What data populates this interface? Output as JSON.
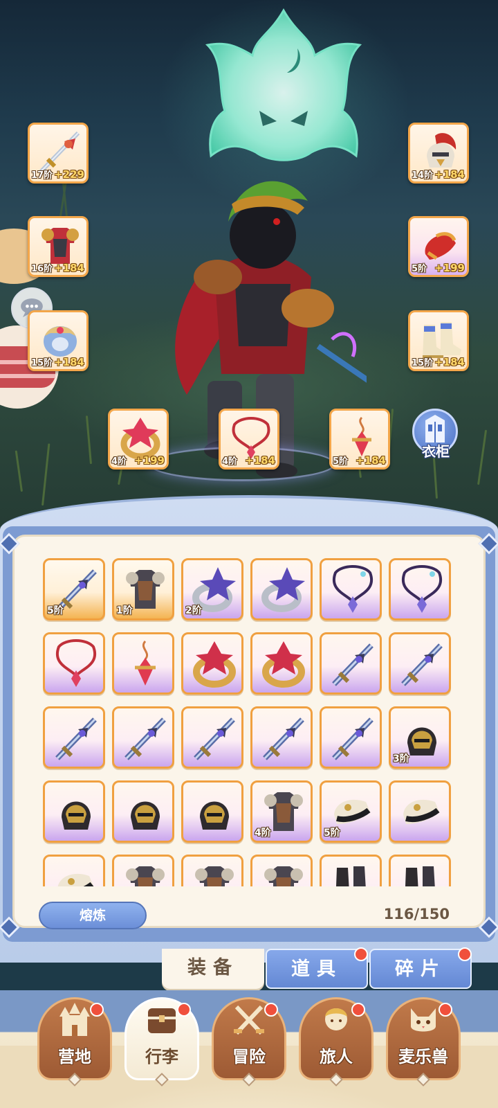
{
  "equipped": {
    "left": [
      {
        "item": "sword",
        "tier": "17阶",
        "bonus": "+229"
      },
      {
        "item": "armor",
        "tier": "16阶",
        "bonus": "+184"
      },
      {
        "item": "pauldron",
        "tier": "15阶",
        "bonus": "+184"
      }
    ],
    "right": [
      {
        "item": "helmet",
        "tier": "14阶",
        "bonus": "+184"
      },
      {
        "item": "gauntlet",
        "tier": "5阶",
        "bonus": "+199"
      },
      {
        "item": "boots",
        "tier": "15阶",
        "bonus": "+184"
      }
    ],
    "bottom": [
      {
        "item": "ring",
        "tier": "4阶",
        "bonus": "+199"
      },
      {
        "item": "necklace",
        "tier": "4阶",
        "bonus": "+184"
      },
      {
        "item": "charm",
        "tier": "5阶",
        "bonus": "+184"
      }
    ]
  },
  "wardrobe": {
    "label": "衣柜"
  },
  "inventory": {
    "items": [
      {
        "icon": "sword-icon",
        "tier": "5阶",
        "rarity": "gold"
      },
      {
        "icon": "armor-icon",
        "tier": "1阶",
        "rarity": "gold"
      },
      {
        "icon": "star-ring-icon",
        "tier": "2阶",
        "rarity": "purple"
      },
      {
        "icon": "star-ring-icon",
        "tier": "",
        "rarity": "purple"
      },
      {
        "icon": "necklace-icon",
        "tier": "",
        "rarity": "purple"
      },
      {
        "icon": "necklace-icon",
        "tier": "",
        "rarity": "purple"
      },
      {
        "icon": "red-necklace-icon",
        "tier": "",
        "rarity": "purple"
      },
      {
        "icon": "charm-icon",
        "tier": "",
        "rarity": "purple"
      },
      {
        "icon": "ruby-ring-icon",
        "tier": "",
        "rarity": "purple"
      },
      {
        "icon": "ruby-ring-icon",
        "tier": "",
        "rarity": "purple"
      },
      {
        "icon": "sword-icon",
        "tier": "",
        "rarity": "purple"
      },
      {
        "icon": "sword-icon",
        "tier": "",
        "rarity": "purple"
      },
      {
        "icon": "sword-icon",
        "tier": "",
        "rarity": "purple"
      },
      {
        "icon": "sword-icon",
        "tier": "",
        "rarity": "purple"
      },
      {
        "icon": "sword-icon",
        "tier": "",
        "rarity": "purple"
      },
      {
        "icon": "sword-icon",
        "tier": "",
        "rarity": "purple"
      },
      {
        "icon": "sword-icon",
        "tier": "",
        "rarity": "purple"
      },
      {
        "icon": "helmet-icon",
        "tier": "3阶",
        "rarity": "purple"
      },
      {
        "icon": "helmet-icon",
        "tier": "",
        "rarity": "purple"
      },
      {
        "icon": "helmet-icon",
        "tier": "",
        "rarity": "purple"
      },
      {
        "icon": "helmet-icon",
        "tier": "",
        "rarity": "purple"
      },
      {
        "icon": "armor-icon",
        "tier": "4阶",
        "rarity": "purple"
      },
      {
        "icon": "gauntlet-icon",
        "tier": "5阶",
        "rarity": "purple"
      },
      {
        "icon": "gauntlet-icon",
        "tier": "",
        "rarity": "purple"
      },
      {
        "icon": "gauntlet-icon",
        "tier": "",
        "rarity": "purple"
      },
      {
        "icon": "armor-icon",
        "tier": "",
        "rarity": "purple"
      },
      {
        "icon": "armor-icon",
        "tier": "",
        "rarity": "purple"
      },
      {
        "icon": "armor-icon",
        "tier": "",
        "rarity": "purple"
      },
      {
        "icon": "boots-icon",
        "tier": "",
        "rarity": "purple"
      },
      {
        "icon": "boots-icon",
        "tier": "",
        "rarity": "purple"
      }
    ],
    "smelt_label": "熔炼",
    "capacity": "116/150"
  },
  "tabs": [
    {
      "label": "装备",
      "active": true,
      "badge": false
    },
    {
      "label": "道具",
      "active": false,
      "badge": true
    },
    {
      "label": "碎片",
      "active": false,
      "badge": true
    }
  ],
  "nav": [
    {
      "label": "营地",
      "icon": "castle-icon",
      "active": false,
      "badge": true
    },
    {
      "label": "行李",
      "icon": "chest-icon",
      "active": true,
      "badge": true
    },
    {
      "label": "冒险",
      "icon": "crossed-swords-icon",
      "active": false,
      "badge": true
    },
    {
      "label": "旅人",
      "icon": "traveler-icon",
      "active": false,
      "badge": true
    },
    {
      "label": "麦乐兽",
      "icon": "beast-icon",
      "active": false,
      "badge": true
    }
  ],
  "colors": {
    "rarity_gold": "#f0a040",
    "rarity_purple": "#caa6ee",
    "tab_active_bg": "#fbf5ea",
    "tab_inactive_bg": "#6c8fd8",
    "badge": "#f0503c"
  }
}
